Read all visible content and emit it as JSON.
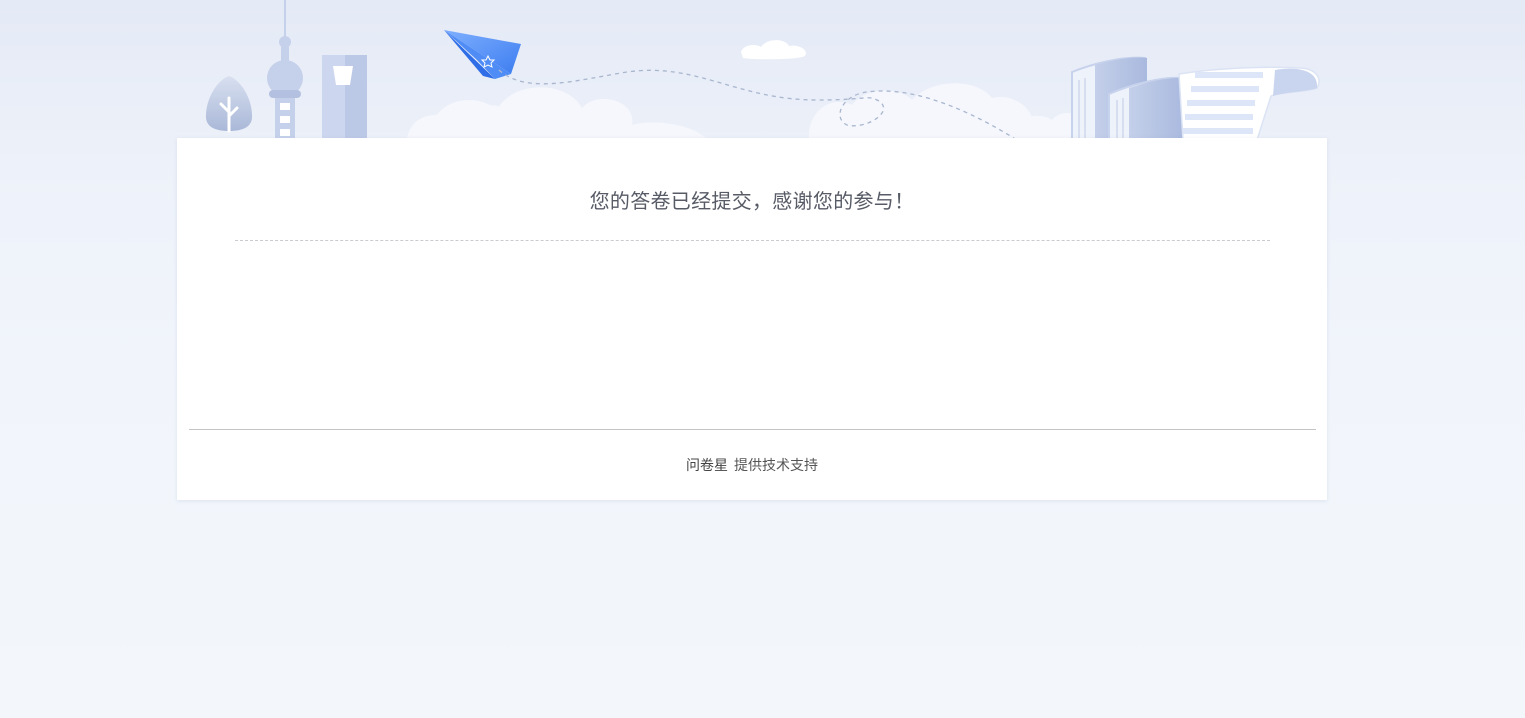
{
  "survey": {
    "submitted_message": "您的答卷已经提交，感谢您的参与！"
  },
  "footer": {
    "brand": "问卷星",
    "support_text": "提供技术支持"
  },
  "theme": {
    "accent": "#4a8ef3",
    "illustration": "#c6d2ec"
  }
}
